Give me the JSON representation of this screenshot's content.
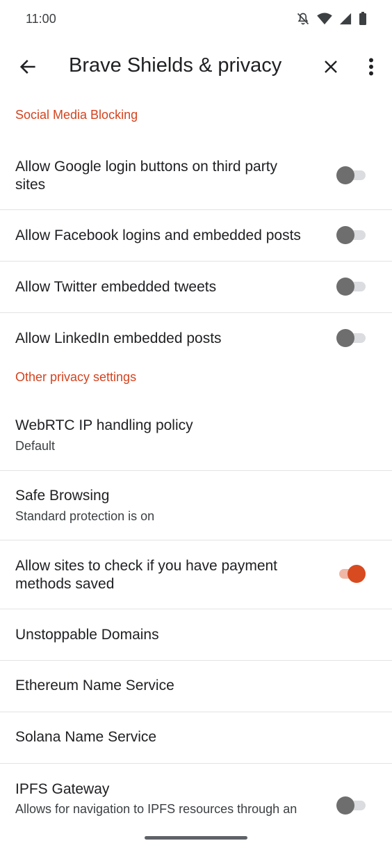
{
  "status_bar": {
    "time": "11:00"
  },
  "app_bar": {
    "title": "Brave Shields & privacy"
  },
  "sections": {
    "social": {
      "header": "Social Media Blocking",
      "items": [
        {
          "title": "Allow Google login buttons on third party sites",
          "checked": false
        },
        {
          "title": "Allow Facebook logins and embedded posts",
          "checked": false
        },
        {
          "title": "Allow Twitter embedded tweets",
          "checked": false
        },
        {
          "title": "Allow LinkedIn embedded posts",
          "checked": false
        }
      ]
    },
    "privacy": {
      "header": "Other privacy settings",
      "items": [
        {
          "title": "WebRTC IP handling policy",
          "subtitle": "Default"
        },
        {
          "title": "Safe Browsing",
          "subtitle": "Standard protection is on"
        },
        {
          "title": "Allow sites to check if you have payment methods saved",
          "checked": true
        },
        {
          "title": "Unstoppable Domains"
        },
        {
          "title": "Ethereum Name Service"
        },
        {
          "title": "Solana Name Service"
        },
        {
          "title": "IPFS Gateway",
          "subtitle": "Allows for navigation to IPFS resources through an",
          "checked": false
        }
      ]
    }
  },
  "colors": {
    "accent": "#d84a1f",
    "section_header": "#d4431f",
    "divider": "#e3e3e3"
  },
  "icons": {
    "back": "arrow-back-icon",
    "close": "close-icon",
    "more": "more-vert-icon"
  }
}
